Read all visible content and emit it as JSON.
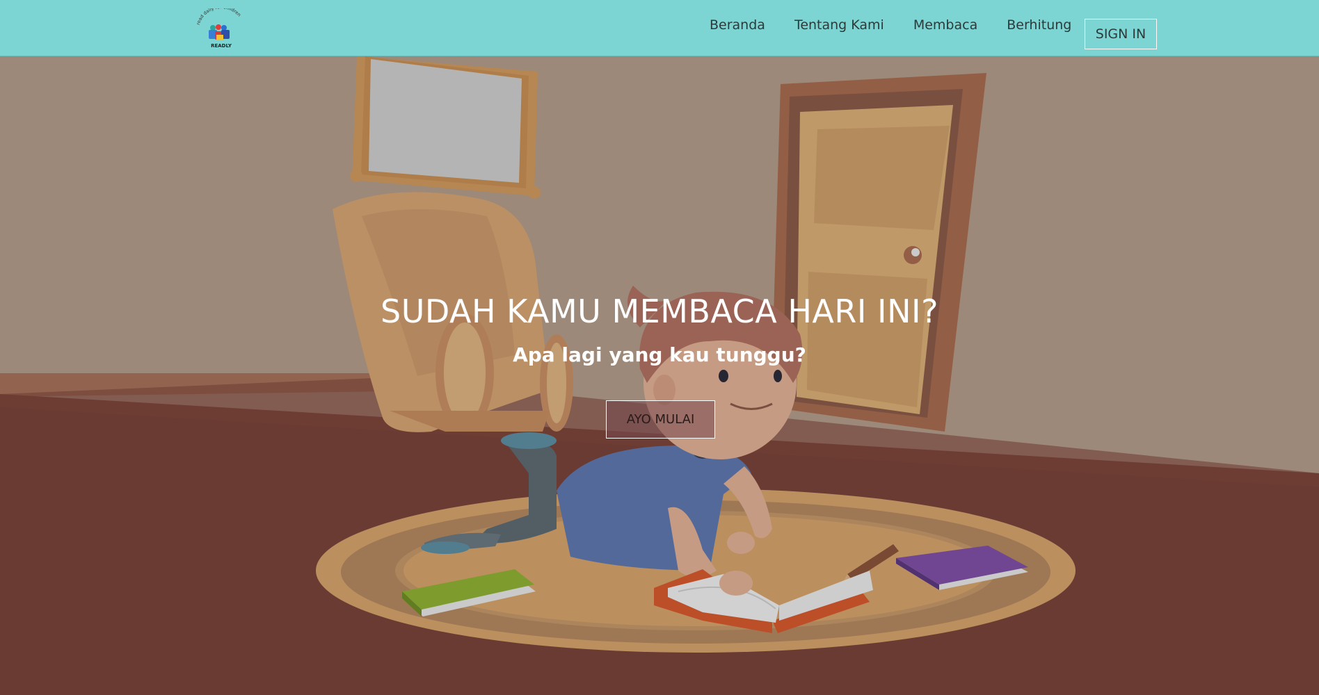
{
  "brand": {
    "logo_tagline": "read daily for children",
    "logo_name": "READLY"
  },
  "nav": {
    "items": [
      {
        "label": "Beranda"
      },
      {
        "label": "Tentang Kami"
      },
      {
        "label": "Membaca"
      },
      {
        "label": "Berhitung"
      }
    ],
    "signin_label": "SIGN IN"
  },
  "hero": {
    "title": "SUDAH KAMU MEMBACA HARI INI?",
    "subtitle": "Apa lagi yang kau tunggu?",
    "cta_label": "AYO MULAI"
  },
  "colors": {
    "navbar": "#7dd5d3",
    "wall": "#b49c8a",
    "floor": "#784238",
    "rug": "#d7a36b"
  }
}
